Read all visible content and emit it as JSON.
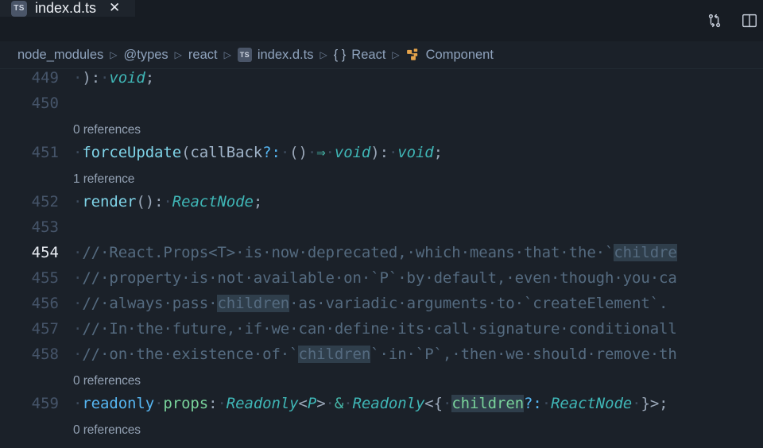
{
  "window": {
    "background": "#1b2129",
    "accent": "#56b6f2"
  },
  "tabs": {
    "items": [
      {
        "label": "index.d.ts",
        "icon": "typescript-icon",
        "icon_text": "TS",
        "close_label": "✕",
        "active": true
      }
    ],
    "actions": [
      {
        "name": "compare-changes-icon"
      },
      {
        "name": "split-editor-icon"
      }
    ]
  },
  "breadcrumb": {
    "separator": "▷",
    "items": [
      {
        "label": "node_modules",
        "icon": null
      },
      {
        "label": "@types",
        "icon": null
      },
      {
        "label": "react",
        "icon": null
      },
      {
        "label": "index.d.ts",
        "icon": "typescript-icon",
        "icon_text": "TS"
      },
      {
        "label": "React",
        "icon": "namespace-braces",
        "icon_text": "{ }"
      },
      {
        "label": "Component",
        "icon": "class-symbol-icon"
      }
    ]
  },
  "editor": {
    "lines": [
      {
        "kind": "code",
        "number": "449",
        "active": false,
        "tokens": [
          {
            "text": "·",
            "cls": "t-ws"
          },
          {
            "text": ")",
            "cls": "t-punct"
          },
          {
            "text": ":",
            "cls": "t-punct"
          },
          {
            "text": "·",
            "cls": "t-ws"
          },
          {
            "text": "void",
            "cls": "t-type"
          },
          {
            "text": ";",
            "cls": "t-punct"
          }
        ]
      },
      {
        "kind": "code",
        "number": "450",
        "active": false,
        "tokens": []
      },
      {
        "kind": "codelens",
        "text": "0 references"
      },
      {
        "kind": "code",
        "number": "451",
        "active": false,
        "tokens": [
          {
            "text": "·",
            "cls": "t-ws"
          },
          {
            "text": "forceUpdate",
            "cls": "t-fn"
          },
          {
            "text": "(",
            "cls": "t-punct"
          },
          {
            "text": "callBack",
            "cls": "t-param"
          },
          {
            "text": "?:",
            "cls": "t-kw"
          },
          {
            "text": "·",
            "cls": "t-ws"
          },
          {
            "text": "(",
            "cls": "t-punct"
          },
          {
            "text": ")",
            "cls": "t-punct"
          },
          {
            "text": "·",
            "cls": "t-ws"
          },
          {
            "text": "⇒",
            "cls": "t-op"
          },
          {
            "text": "·",
            "cls": "t-ws"
          },
          {
            "text": "void",
            "cls": "t-type"
          },
          {
            "text": ")",
            "cls": "t-punct"
          },
          {
            "text": ":",
            "cls": "t-punct"
          },
          {
            "text": "·",
            "cls": "t-ws"
          },
          {
            "text": "void",
            "cls": "t-type"
          },
          {
            "text": ";",
            "cls": "t-punct"
          }
        ]
      },
      {
        "kind": "codelens",
        "text": "1 reference"
      },
      {
        "kind": "code",
        "number": "452",
        "active": false,
        "tokens": [
          {
            "text": "·",
            "cls": "t-ws"
          },
          {
            "text": "render",
            "cls": "t-fn"
          },
          {
            "text": "(",
            "cls": "t-punct"
          },
          {
            "text": ")",
            "cls": "t-punct"
          },
          {
            "text": ":",
            "cls": "t-punct"
          },
          {
            "text": "·",
            "cls": "t-ws"
          },
          {
            "text": "ReactNode",
            "cls": "t-type"
          },
          {
            "text": ";",
            "cls": "t-punct"
          }
        ]
      },
      {
        "kind": "code",
        "number": "453",
        "active": false,
        "tokens": []
      },
      {
        "kind": "code",
        "number": "454",
        "active": true,
        "tokens": [
          {
            "text": "·",
            "cls": "t-ws"
          },
          {
            "text": "//·React.Props<T>·is·now·deprecated,·which·means·that·the·`",
            "cls": "t-comment"
          },
          {
            "text": "childre",
            "cls": "t-comment",
            "highlight": true
          }
        ]
      },
      {
        "kind": "code",
        "number": "455",
        "active": false,
        "tokens": [
          {
            "text": "·",
            "cls": "t-ws"
          },
          {
            "text": "//·property·is·not·available·on·`P`·by·default,·even·though·you·ca",
            "cls": "t-comment"
          }
        ]
      },
      {
        "kind": "code",
        "number": "456",
        "active": false,
        "tokens": [
          {
            "text": "·",
            "cls": "t-ws"
          },
          {
            "text": "//·always·pass·",
            "cls": "t-comment"
          },
          {
            "text": "children",
            "cls": "t-comment",
            "highlight": true
          },
          {
            "text": "·as·variadic·arguments·to·`createElement`.",
            "cls": "t-comment"
          }
        ]
      },
      {
        "kind": "code",
        "number": "457",
        "active": false,
        "tokens": [
          {
            "text": "·",
            "cls": "t-ws"
          },
          {
            "text": "//·In·the·future,·if·we·can·define·its·call·signature·conditionall",
            "cls": "t-comment"
          }
        ]
      },
      {
        "kind": "code",
        "number": "458",
        "active": false,
        "tokens": [
          {
            "text": "·",
            "cls": "t-ws"
          },
          {
            "text": "//·on·the·existence·of·`",
            "cls": "t-comment"
          },
          {
            "text": "children",
            "cls": "t-comment",
            "highlight": true
          },
          {
            "text": "`·in·`P`,·then·we·should·remove·th",
            "cls": "t-comment"
          }
        ]
      },
      {
        "kind": "codelens",
        "text": "0 references"
      },
      {
        "kind": "code",
        "number": "459",
        "active": false,
        "tokens": [
          {
            "text": "·",
            "cls": "t-ws"
          },
          {
            "text": "readonly",
            "cls": "t-kw"
          },
          {
            "text": "·",
            "cls": "t-ws"
          },
          {
            "text": "props",
            "cls": "t-prop"
          },
          {
            "text": ":",
            "cls": "t-punct"
          },
          {
            "text": "·",
            "cls": "t-ws"
          },
          {
            "text": "Readonly",
            "cls": "t-type"
          },
          {
            "text": "<",
            "cls": "t-punct"
          },
          {
            "text": "P",
            "cls": "t-type"
          },
          {
            "text": ">",
            "cls": "t-punct"
          },
          {
            "text": "·",
            "cls": "t-ws"
          },
          {
            "text": "&",
            "cls": "t-op"
          },
          {
            "text": "·",
            "cls": "t-ws"
          },
          {
            "text": "Readonly",
            "cls": "t-type"
          },
          {
            "text": "<{",
            "cls": "t-punct"
          },
          {
            "text": "·",
            "cls": "t-ws"
          },
          {
            "text": "children",
            "cls": "t-green",
            "highlight": true
          },
          {
            "text": "?:",
            "cls": "t-kw"
          },
          {
            "text": "·",
            "cls": "t-ws"
          },
          {
            "text": "ReactNode",
            "cls": "t-type"
          },
          {
            "text": "·",
            "cls": "t-ws"
          },
          {
            "text": "}>",
            "cls": "t-punct"
          },
          {
            "text": ";",
            "cls": "t-punct"
          }
        ]
      },
      {
        "kind": "codelens",
        "text": "0 references"
      }
    ]
  }
}
